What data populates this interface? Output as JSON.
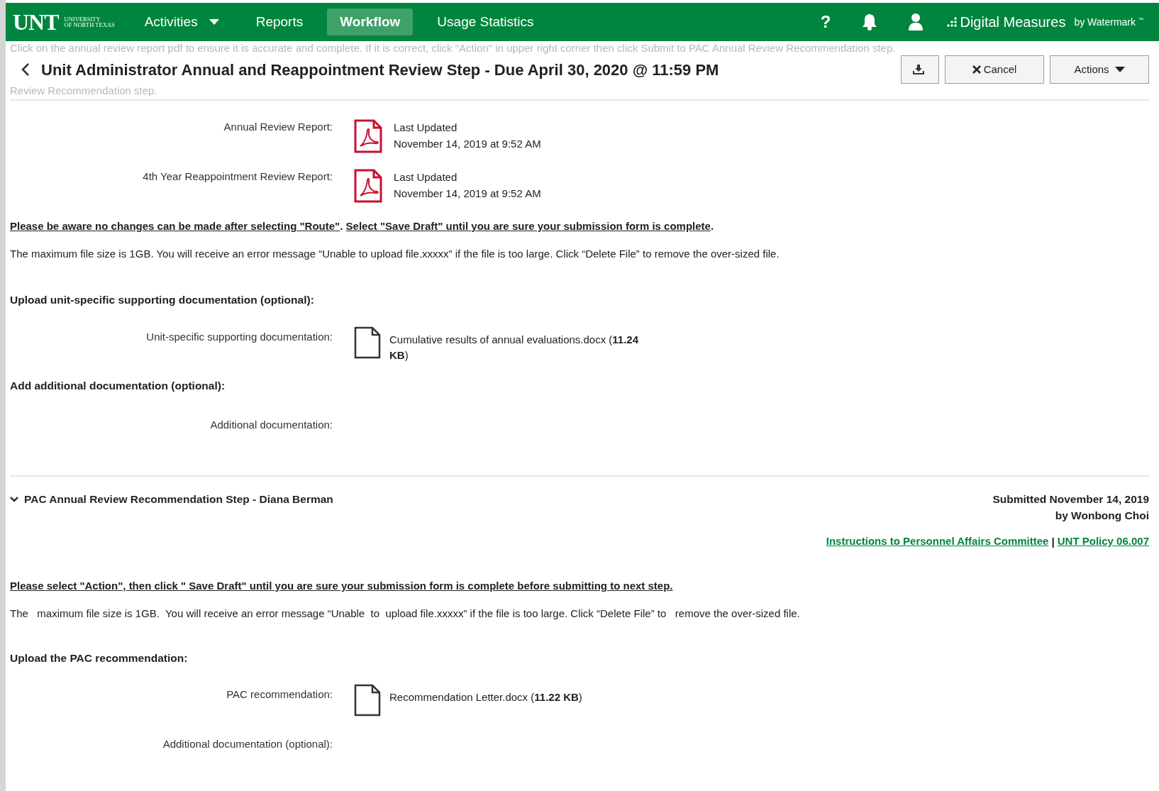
{
  "navbar": {
    "logo": {
      "mark": "UNT",
      "lines": [
        "UNIVERSITY",
        "OF NORTH TEXAS"
      ]
    },
    "items": [
      {
        "label": "Activities",
        "selected": false,
        "dropdown": true
      },
      {
        "label": "Reports",
        "selected": false,
        "dropdown": false
      },
      {
        "label": "Workflow",
        "selected": true,
        "dropdown": false
      },
      {
        "label": "Usage Statistics",
        "selected": false,
        "dropdown": false
      }
    ],
    "help": "?",
    "brand": {
      "name": "Digital Measures",
      "by": "by Watermark",
      "tm": "™"
    }
  },
  "background_note": [
    "Click on the annual review  report pdf to ensure it is accurate and complete.  If it is correct,  click \"Action\" in upper right corner then click Submit to PAC Annual  Review Recommendation step.",
    "Review Recommendation  step."
  ],
  "header": {
    "title": "Unit Administrator Annual and Reappointment Review Step - Due April 30, 2020 @ 11:59 PM",
    "buttons": [
      {
        "kind": "download"
      },
      {
        "kind": "cancel",
        "label": "Cancel"
      },
      {
        "kind": "actions",
        "label": "Actions"
      }
    ]
  },
  "reports": [
    {
      "label": "Annual Review Report:",
      "status": "Last Updated",
      "date": "November 14, 2019 at 9:52 AM"
    },
    {
      "label": "4th Year Reappointment Review Report:",
      "status": "Last Updated",
      "date": "November 14, 2019 at 9:52 AM"
    }
  ],
  "warning": [
    {
      "text": "Please be aware no changes can be made after selecting \"Route\"",
      "underlined": true
    },
    {
      "text": ". ",
      "underlined": false
    },
    {
      "text": "Select \"Save Draft\" until you are sure your submission form is complete",
      "underlined": true
    },
    {
      "text": ".",
      "underlined": false
    }
  ],
  "size_note": "The maximum file size is 1GB.  You will receive an error message “Unable to upload file.xxxxx” if the file is too large. Click “Delete File” to remove the over-sized file.",
  "sections": [
    {
      "heading": "Upload unit-specific supporting documentation (optional):",
      "fields": [
        {
          "label": "Unit-specific supporting documentation:",
          "file": "Cumulative results of annual evaluations.docx (**11.24 KB**)"
        }
      ]
    },
    {
      "heading": "Add additional documentation (optional):",
      "fields": [
        {
          "label": "Additional documentation:"
        }
      ]
    }
  ],
  "pac_step": {
    "title": "PAC Annual Review Recommendation Step - Diana Berman",
    "expanded": true,
    "submitted": "Submitted November 14, 2019",
    "by": "by Wonbong Choi",
    "links": [
      {
        "label": "Instructions to Personnel Affairs Committee"
      },
      {
        "label": "UNT Policy 06.007"
      }
    ],
    "separator": "|",
    "instruction": "Please  select \"Action\",  then click \" Save Draft\" until you are sure your  submission form is complete before submitting to next step.",
    "size_note": "The   maximum file size is 1GB.  You will receive an error message “Unable  to  upload file.xxxxx” if the file is too large. Click “Delete File” to   remove the over-sized file.",
    "sections": [
      {
        "heading": "Upload the PAC recommendation:",
        "fields": [
          {
            "label": "PAC recommendation:",
            "file": "Recommendation Letter.docx (**11.22 KB**)"
          },
          {
            "label": "Additional documentation (optional):"
          }
        ]
      }
    ]
  }
}
